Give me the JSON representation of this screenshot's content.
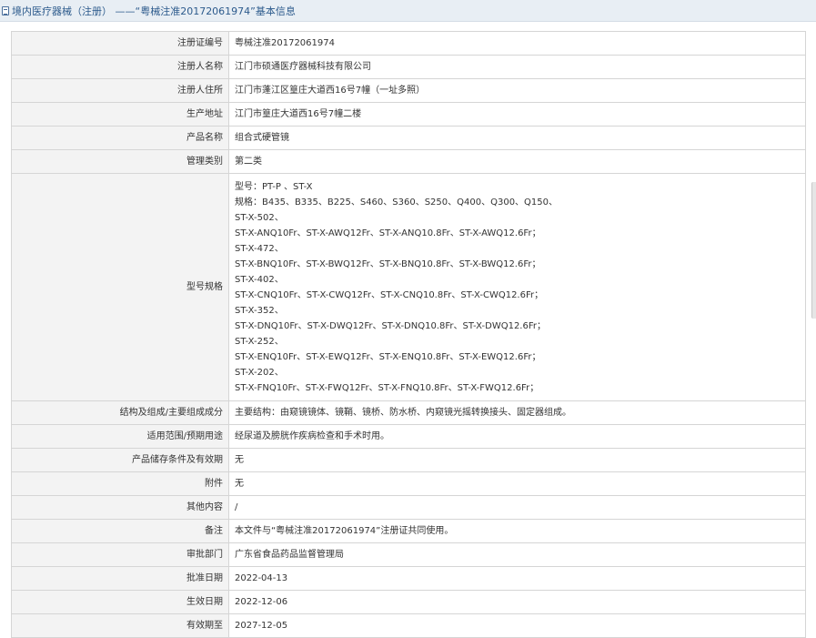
{
  "page": {
    "title": "境内医疗器械（注册） ——“粤械注准20172061974”基本信息"
  },
  "fields": [
    {
      "label": "注册证编号",
      "value": "粤械注准20172061974"
    },
    {
      "label": "注册人名称",
      "value": "江门市硕通医疗器械科技有限公司"
    },
    {
      "label": "注册人住所",
      "value": "江门市蓬江区篁庄大道西16号7幢（一址多照）"
    },
    {
      "label": "生产地址",
      "value": "江门市篁庄大道西16号7幢二楼"
    },
    {
      "label": "产品名称",
      "value": "组合式硬管镜"
    },
    {
      "label": "管理类别",
      "value": "第二类"
    },
    {
      "label": "型号规格",
      "value": ""
    },
    {
      "label": "结构及组成/主要组成成分",
      "value": "主要结构：由窥镜镜体、镜鞘、镜桥、防水桥、内窥镜光摇转换接头、固定器组成。"
    },
    {
      "label": "适用范围/预期用途",
      "value": "经尿道及膀胱作疾病检查和手术时用。"
    },
    {
      "label": "产品储存条件及有效期",
      "value": "无"
    },
    {
      "label": "附件",
      "value": "无"
    },
    {
      "label": "其他内容",
      "value": "/"
    },
    {
      "label": "备注",
      "value": "本文件与“粤械注准20172061974”注册证共同使用。"
    },
    {
      "label": "审批部门",
      "value": "广东省食品药品监督管理局"
    },
    {
      "label": "批准日期",
      "value": "2022-04-13"
    },
    {
      "label": "生效日期",
      "value": "2022-12-06"
    },
    {
      "label": "有效期至",
      "value": "2027-12-05"
    }
  ],
  "spec_lines": [
    "型号：PT-P 、ST-X",
    "规格：B435、B335、B225、S460、S360、S250、Q400、Q300、Q150、",
    "ST-X-502、",
    "ST-X-ANQ10Fr、ST-X-AWQ12Fr、ST-X-ANQ10.8Fr、ST-X-AWQ12.6Fr；",
    "ST-X-472、",
    "ST-X-BNQ10Fr、ST-X-BWQ12Fr、ST-X-BNQ10.8Fr、ST-X-BWQ12.6Fr；",
    "ST-X-402、",
    "ST-X-CNQ10Fr、ST-X-CWQ12Fr、ST-X-CNQ10.8Fr、ST-X-CWQ12.6Fr；",
    "ST-X-352、",
    "ST-X-DNQ10Fr、ST-X-DWQ12Fr、ST-X-DNQ10.8Fr、ST-X-DWQ12.6Fr；",
    "ST-X-252、",
    "ST-X-ENQ10Fr、ST-X-EWQ12Fr、ST-X-ENQ10.8Fr、ST-X-EWQ12.6Fr；",
    "ST-X-202、",
    "ST-X-FNQ10Fr、ST-X-FWQ12Fr、ST-X-FNQ10.8Fr、ST-X-FWQ12.6Fr；"
  ],
  "icons": {
    "title_icon": "document-icon"
  }
}
